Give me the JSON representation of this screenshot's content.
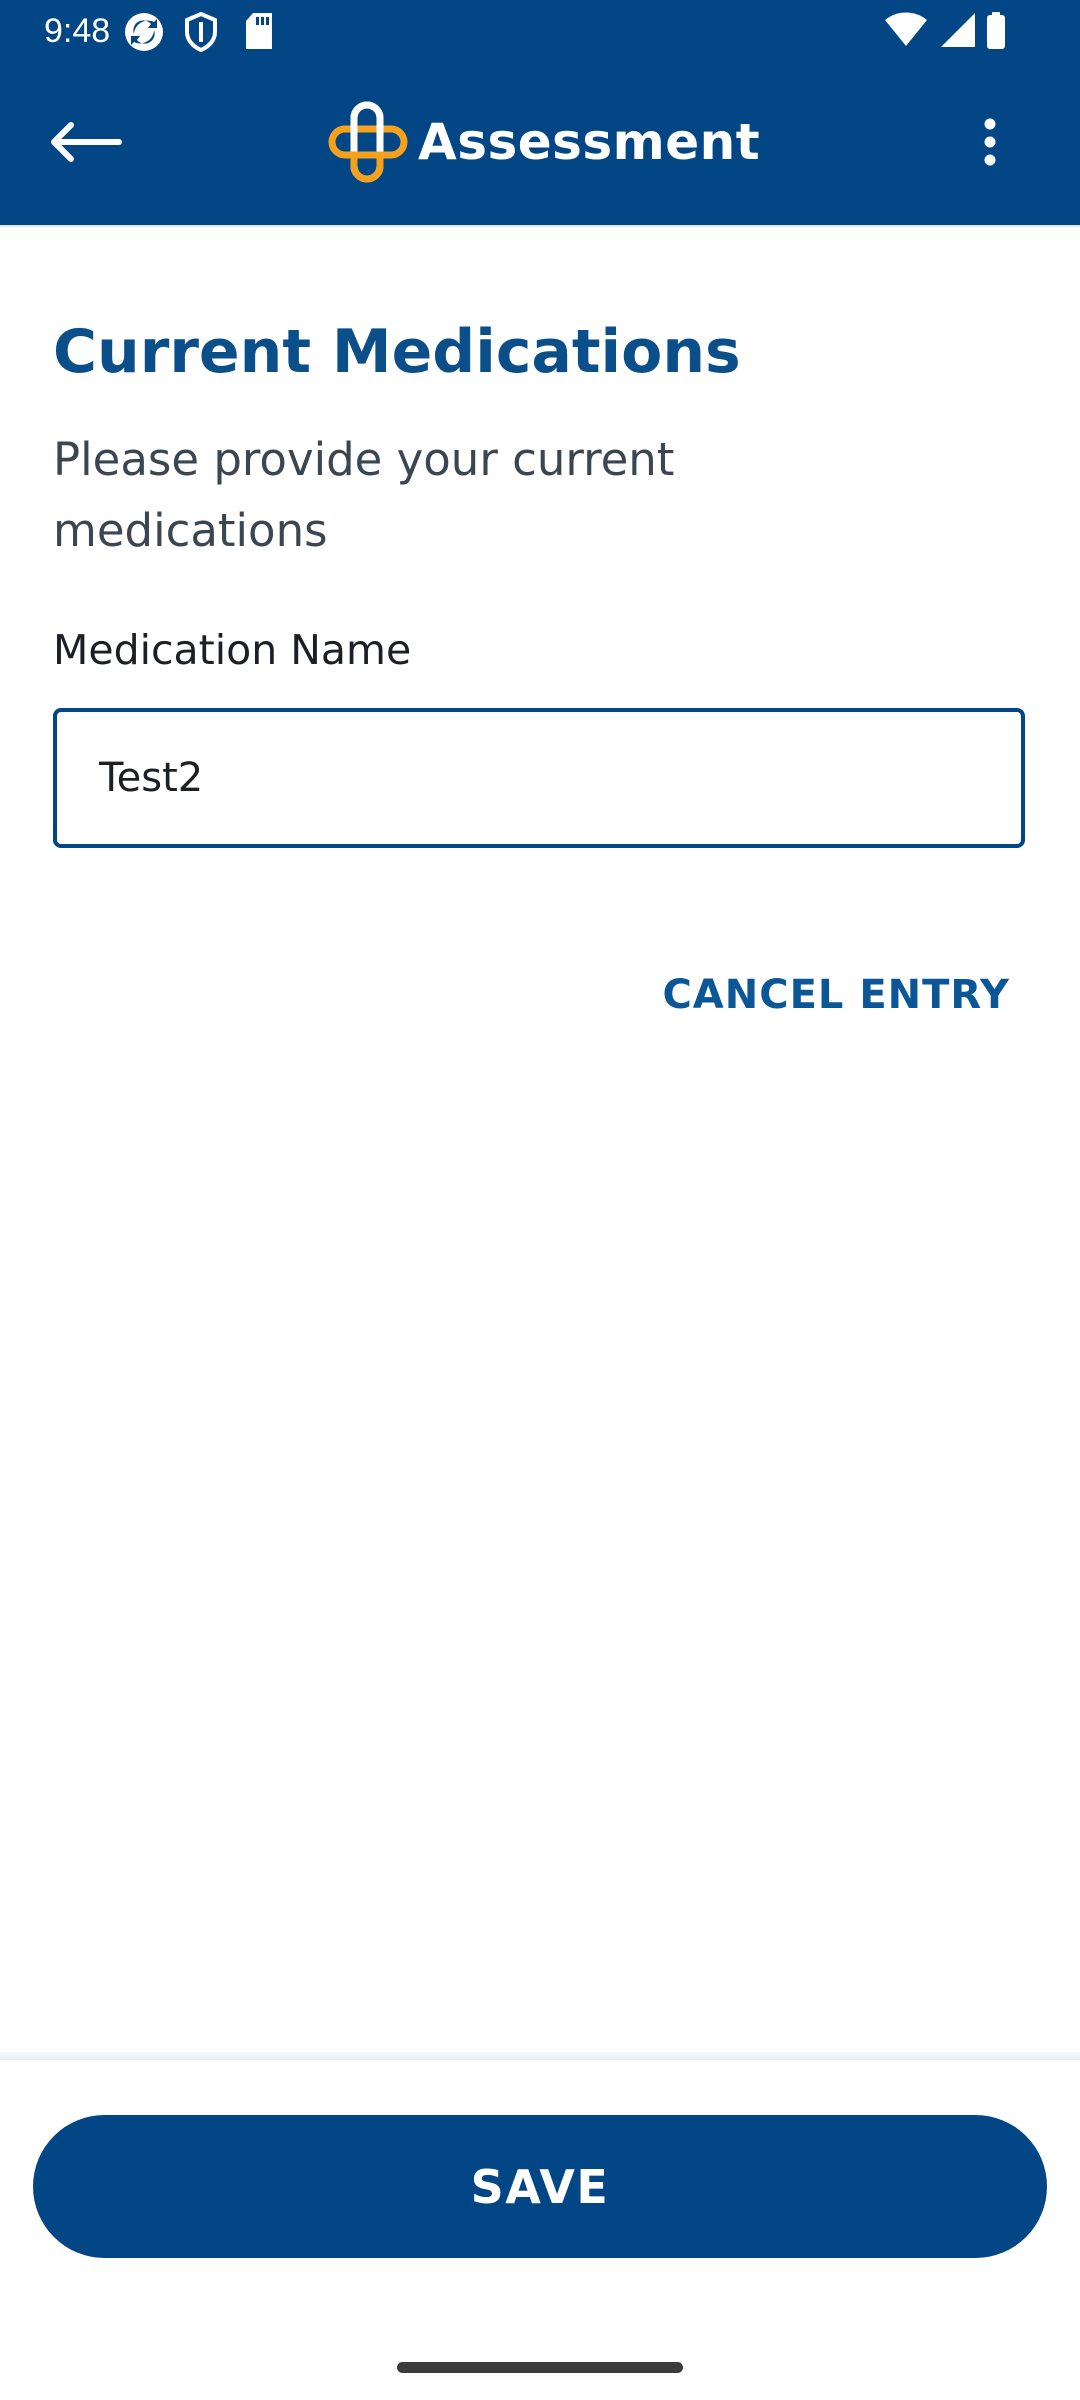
{
  "status_bar": {
    "time": "9:48",
    "icons": [
      "sync-icon",
      "shield-icon",
      "sd-card-icon",
      "wifi-icon",
      "signal-icon",
      "battery-icon"
    ]
  },
  "app_bar": {
    "title": "Assessment",
    "icons": [
      "back-arrow-icon",
      "cross-logo-icon",
      "more-vert-icon"
    ]
  },
  "content": {
    "title": "Current Medications",
    "subtitle": "Please provide your current medications",
    "medication_label": "Medication Name",
    "medication_value": "Test2",
    "cancel_label": "CANCEL ENTRY"
  },
  "footer": {
    "save_label": "SAVE"
  },
  "colors": {
    "primary": "#034685",
    "logo_orange": "#f4a21e",
    "title_blue": "#0b4f8a",
    "link_blue": "#0b5696"
  }
}
